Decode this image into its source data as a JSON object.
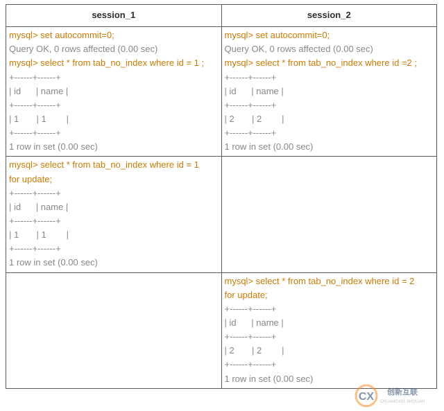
{
  "header": {
    "col1": "session_1",
    "col2": "session_2"
  },
  "row1": {
    "left": {
      "l1a": "mysql> ",
      "l1b": "set autocommit=0;",
      "l2": "Query OK, 0 rows affected (0.00 sec)",
      "l3a": "mysql> ",
      "l3b": "select * from tab_no_index where id = 1 ;",
      "l4": "+------+------+",
      "l5": "| id      | name |",
      "l6": "+------+------+",
      "l7": "| 1       | 1        |",
      "l8": "+------+------+",
      "l9": "1 row in set (0.00 sec)"
    },
    "right": {
      "l1a": "mysql> ",
      "l1b": "set autocommit=0;",
      "l2": "Query OK, 0 rows affected (0.00 sec)",
      "l3a": "mysql> ",
      "l3b": "select * from tab_no_index where id =2 ;",
      "l4": "+------+------+",
      "l5": "| id      | name |",
      "l6": "+------+------+",
      "l7": "| 2       | 2        |",
      "l8": "+------+------+",
      "l9": "1 row in set (0.00 sec)"
    }
  },
  "row2": {
    "left": {
      "l1a": "mysql> ",
      "l1b": "select * from tab_no_index where id = 1",
      "l1c": "for update;",
      "l2": "+------+------+",
      "l3": "| id      | name |",
      "l4": "+------+------+",
      "l5": "| 1       | 1        |",
      "l6": "+------+------+",
      "l7": "1 row in set (0.00 sec)"
    },
    "right": ""
  },
  "row3": {
    "left": "",
    "right": {
      "l1a": "mysql> ",
      "l1b": "select * from tab_no_index where id = 2",
      "l1c": "for update;",
      "l2": "+------+------+",
      "l3": "| id      | name |",
      "l4": "+------+------+",
      "l5": "| 2       | 2        |",
      "l6": "+------+------+",
      "l7": "1 row in set (0.00 sec)"
    }
  },
  "watermark": {
    "big": "CX",
    "small": "创新互联"
  }
}
